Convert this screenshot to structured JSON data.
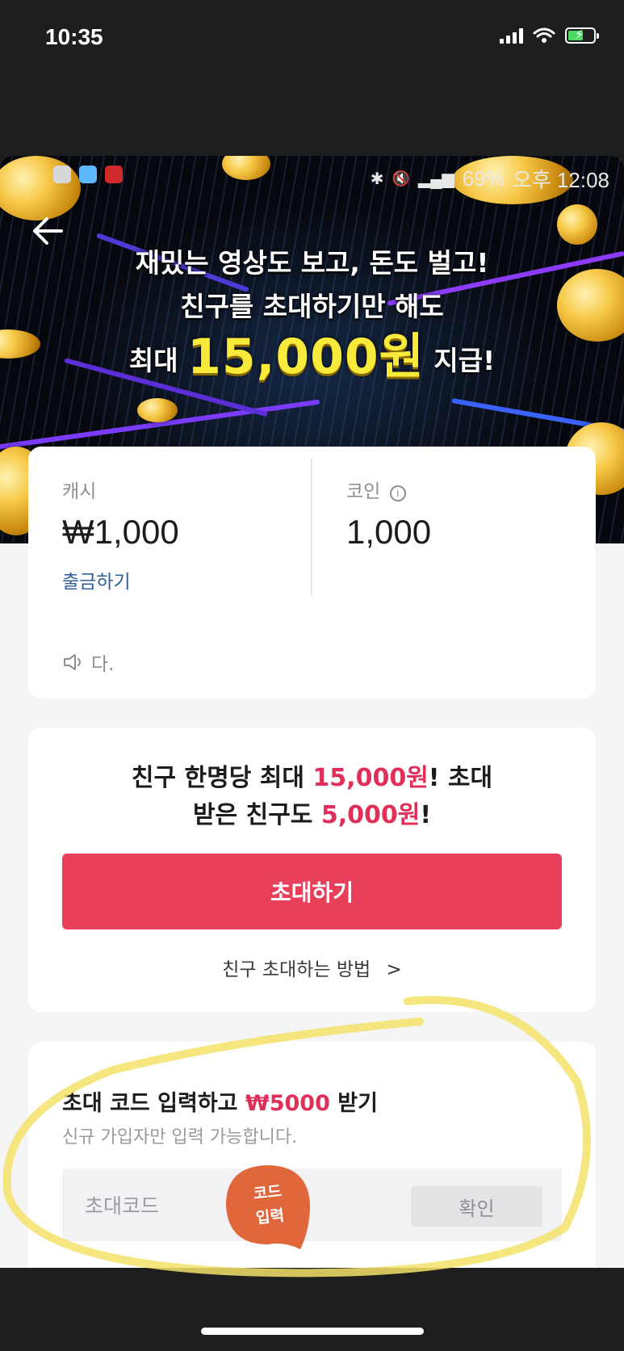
{
  "ios_status": {
    "time": "10:35"
  },
  "android_status": {
    "battery": "69%",
    "time": "오후 12:08"
  },
  "banner": {
    "line1": "재밌는 영상도 보고, 돈도 벌고!",
    "line2": "친구를 초대하기만 해도",
    "line3_prefix": "최대",
    "line3_amount": "15,000원",
    "line3_suffix": "지급!"
  },
  "balance": {
    "cash_label": "캐시",
    "cash_value": "₩1,000",
    "withdraw_label": "출금하기",
    "coin_label": "코인",
    "coin_value": "1,000",
    "notice_text": "다."
  },
  "invite": {
    "title_a": "친구 한명당 최대 ",
    "title_amount1": "15,000원",
    "title_b": "! 초대",
    "title_c": "받은 친구도 ",
    "title_amount2": "5,000원",
    "title_d": "!",
    "button_label": "초대하기",
    "howto_label": "친구 초대하는 방법",
    "howto_chevron": ">"
  },
  "code": {
    "title_a": "초대 코드 입력하고 ",
    "title_amount": "₩5000",
    "title_b": " 받기",
    "subtitle": "신규 가입자만 입력 가능합니다.",
    "input_placeholder": "초대코드",
    "confirm_label": "확인"
  },
  "annotation": {
    "line1": "코드",
    "line2": "입력"
  },
  "colors": {
    "accent_pink": "#e8405a",
    "amount_pink": "#e0305a",
    "link_blue": "#2f5f9a",
    "highlight_yellow": "#f4e26a",
    "bubble_orange": "#e0663b"
  }
}
